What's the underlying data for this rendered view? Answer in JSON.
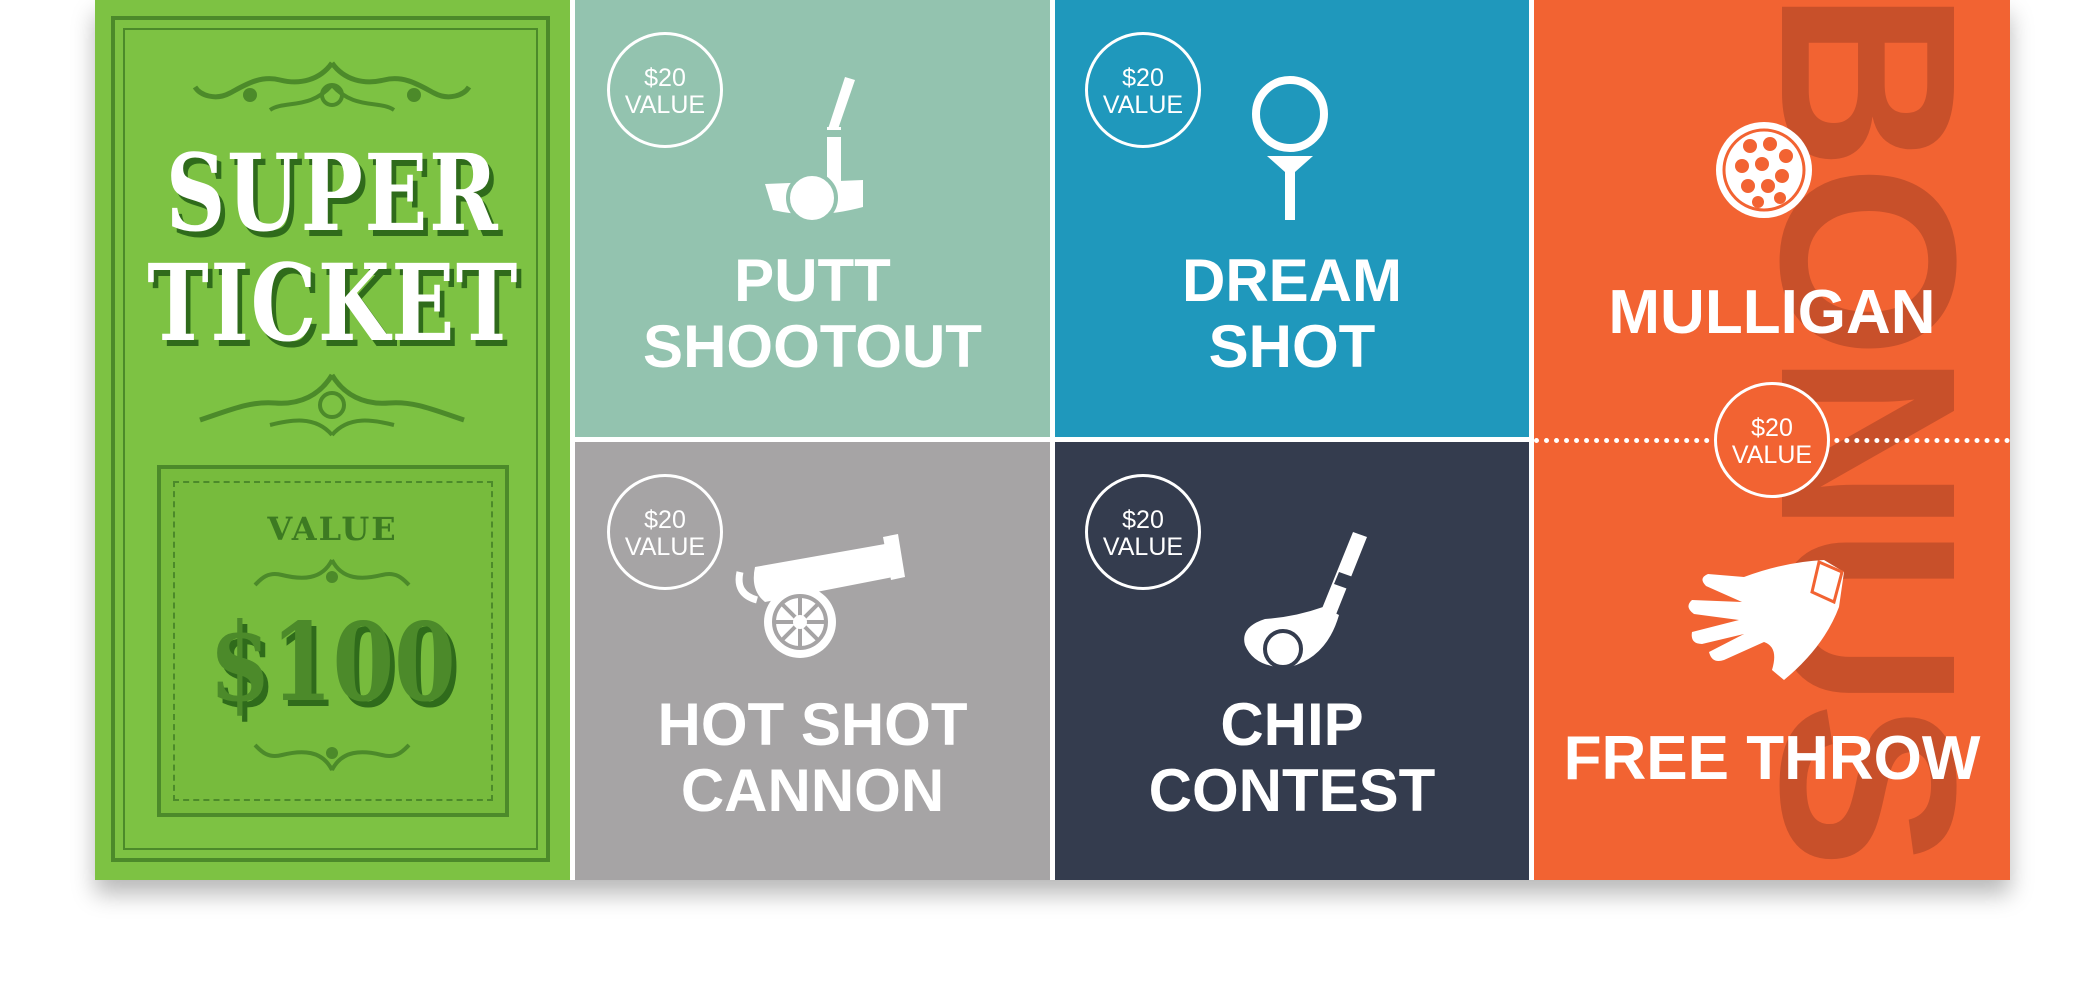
{
  "ticket": {
    "title_line1": "SUPER",
    "title_line2": "TICKET",
    "value_word": "VALUE",
    "value_amount": "$100"
  },
  "cells": {
    "putt": {
      "line1": "PUTT",
      "line2": "SHOOTOUT",
      "badge_price": "$20",
      "badge_word": "VALUE",
      "icon": "putter-icon"
    },
    "dream": {
      "line1": "DREAM",
      "line2": "SHOT",
      "badge_price": "$20",
      "badge_word": "VALUE",
      "icon": "golf-tee-icon"
    },
    "hotshot": {
      "line1": "HOT SHOT",
      "line2": "CANNON",
      "badge_price": "$20",
      "badge_word": "VALUE",
      "icon": "cannon-icon"
    },
    "chip": {
      "line1": "CHIP",
      "line2": "CONTEST",
      "badge_price": "$20",
      "badge_word": "VALUE",
      "icon": "wedge-club-icon"
    }
  },
  "bonus": {
    "vertical_text": "BONUS",
    "mulligan": "MULLIGAN",
    "free_throw": "FREE THROW",
    "badge_price": "$20",
    "badge_word": "VALUE",
    "icons": [
      "golf-ball-icon",
      "golf-glove-icon"
    ]
  },
  "colors": {
    "green": "#7dc243",
    "sage": "#93c3af",
    "blue": "#1f98bc",
    "gray": "#a6a4a5",
    "navy": "#343c4e",
    "orange": "#f26332"
  }
}
